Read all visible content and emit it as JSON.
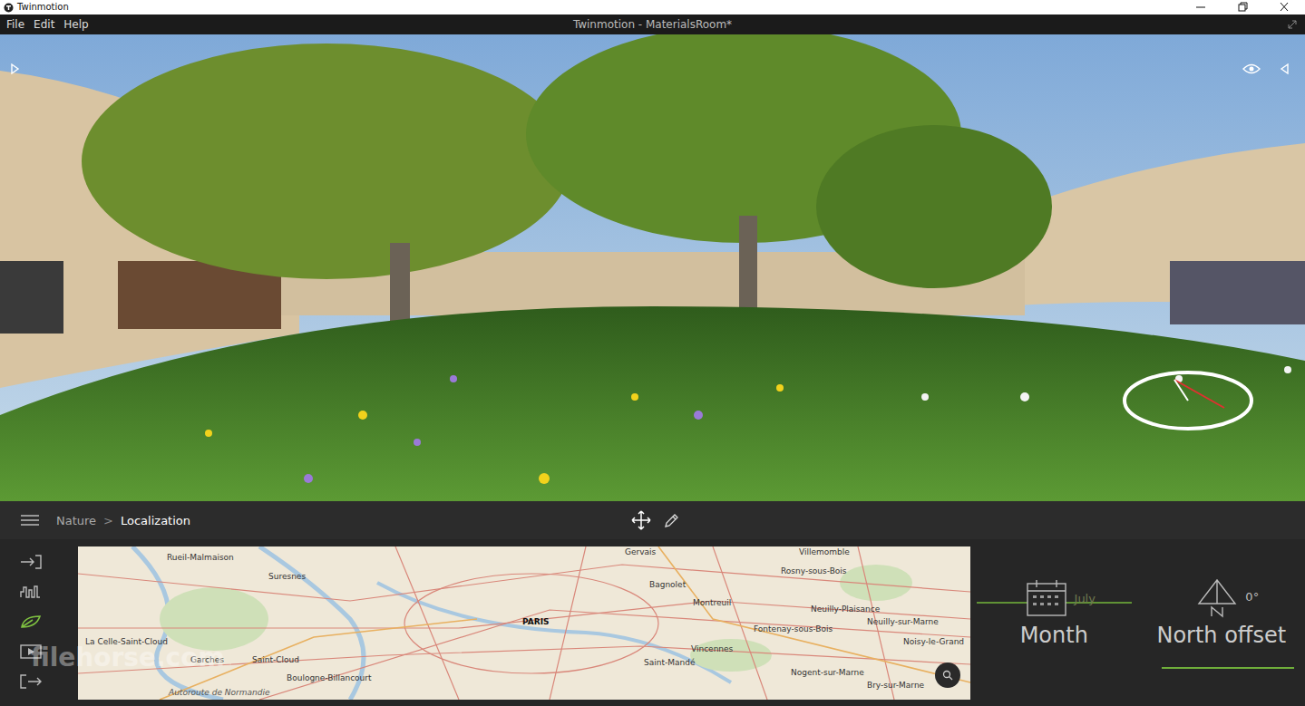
{
  "window": {
    "app_name": "Twinmotion",
    "title": "Twinmotion - MaterialsRoom*"
  },
  "menu": [
    "File",
    "Edit",
    "Help"
  ],
  "breadcrumb": {
    "separator": ">",
    "items": [
      {
        "label": "Nature",
        "selected": false
      },
      {
        "label": "Localization",
        "selected": true
      }
    ]
  },
  "sidebar": {
    "items": [
      {
        "kind": "import",
        "selected": false
      },
      {
        "kind": "graph",
        "selected": false
      },
      {
        "kind": "nature",
        "selected": true
      },
      {
        "kind": "media",
        "selected": false
      },
      {
        "kind": "export",
        "selected": false
      }
    ]
  },
  "map": {
    "labels": [
      {
        "text": "Rueil-Malmaison",
        "kind": "town"
      },
      {
        "text": "Suresnes",
        "kind": "town"
      },
      {
        "text": "Gervais",
        "kind": "town"
      },
      {
        "text": "Villemomble",
        "kind": "town"
      },
      {
        "text": "Bagnolet",
        "kind": "town"
      },
      {
        "text": "Rosny-sous-Bois",
        "kind": "town"
      },
      {
        "text": "Montreuil",
        "kind": "town"
      },
      {
        "text": "Neuilly-Plaisance",
        "kind": "town"
      },
      {
        "text": "PARIS",
        "kind": "city"
      },
      {
        "text": "Neuilly-sur-Marne",
        "kind": "town"
      },
      {
        "text": "Fontenay-sous-Bois",
        "kind": "town"
      },
      {
        "text": "La Celle-Saint-Cloud",
        "kind": "town"
      },
      {
        "text": "Noisy-le-Grand",
        "kind": "town"
      },
      {
        "text": "Vincennes",
        "kind": "town"
      },
      {
        "text": "Garches",
        "kind": "town"
      },
      {
        "text": "Saint-Cloud",
        "kind": "town"
      },
      {
        "text": "Saint-Mandé",
        "kind": "town"
      },
      {
        "text": "Nogent-sur-Marne",
        "kind": "town"
      },
      {
        "text": "Boulogne-Billancourt",
        "kind": "town"
      },
      {
        "text": "Bry-sur-Marne",
        "kind": "town"
      },
      {
        "text": "Autoroute de Normandie",
        "kind": "road"
      }
    ]
  },
  "month": {
    "value": "July",
    "label": "Month"
  },
  "north_offset": {
    "value": "0°",
    "label": "North offset"
  },
  "watermark": "filehorse.com"
}
